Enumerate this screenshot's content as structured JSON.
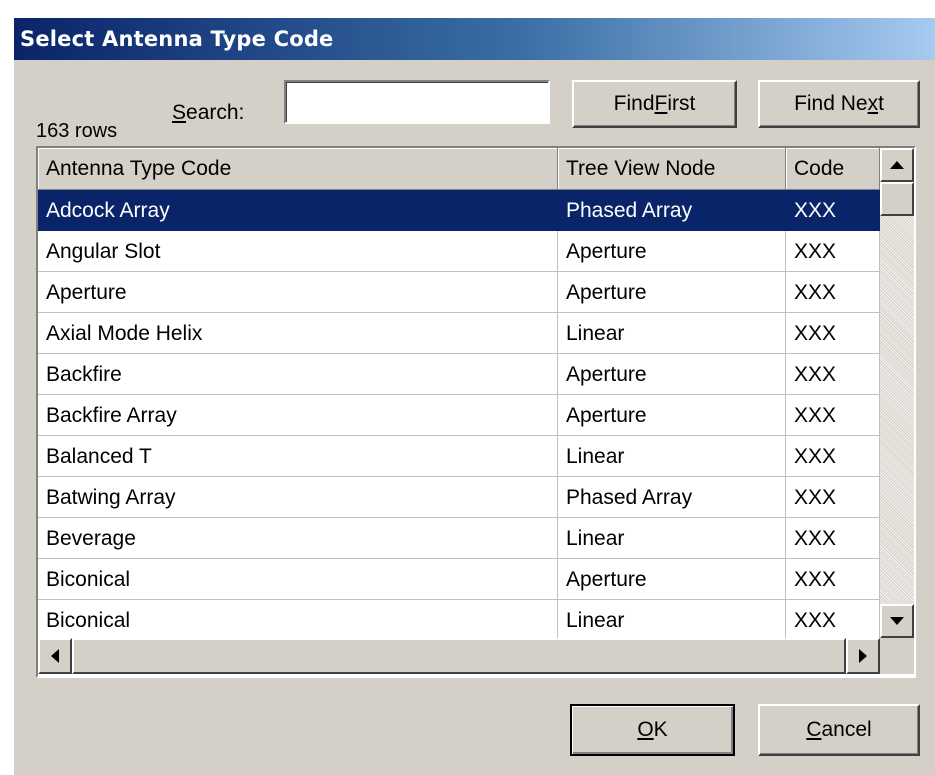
{
  "dialog": {
    "title": "Select Antenna Type Code",
    "row_count": "163 rows",
    "search": {
      "label_prefix": "",
      "label_mnemonic": "S",
      "label_suffix": "earch:",
      "value": "",
      "placeholder": ""
    },
    "buttons": {
      "find_first": {
        "prefix": "Find ",
        "mnemonic": "F",
        "suffix": "irst"
      },
      "find_next": {
        "prefix": "Find Ne",
        "mnemonic": "x",
        "suffix": "t"
      },
      "ok": {
        "prefix": "",
        "mnemonic": "O",
        "suffix": "K"
      },
      "cancel": {
        "prefix": "",
        "mnemonic": "C",
        "suffix": "ancel"
      }
    }
  },
  "grid": {
    "columns": [
      "Antenna Type Code",
      "Tree View Node",
      "Code"
    ],
    "selected_index": 0,
    "rows": [
      [
        "Adcock Array",
        "Phased Array",
        "XXX"
      ],
      [
        "Angular Slot",
        "Aperture",
        "XXX"
      ],
      [
        "Aperture",
        "Aperture",
        "XXX"
      ],
      [
        "Axial Mode Helix",
        "Linear",
        "XXX"
      ],
      [
        "Backfire",
        "Aperture",
        "XXX"
      ],
      [
        "Backfire Array",
        "Aperture",
        "XXX"
      ],
      [
        "Balanced T",
        "Linear",
        "XXX"
      ],
      [
        "Batwing Array",
        "Phased Array",
        "XXX"
      ],
      [
        "Beverage",
        "Linear",
        "XXX"
      ],
      [
        "Biconical",
        "Aperture",
        "XXX"
      ],
      [
        "Biconical",
        "Linear",
        "XXX"
      ]
    ]
  },
  "icons": {
    "scroll_up": "arrow-up-icon",
    "scroll_down": "arrow-down-icon",
    "scroll_left": "arrow-left-icon",
    "scroll_right": "arrow-right-icon"
  },
  "colors": {
    "title_gradient_start": "#0a246a",
    "title_gradient_end": "#a6caf0",
    "selection": "#0a246a",
    "face": "#d4d0c8"
  }
}
